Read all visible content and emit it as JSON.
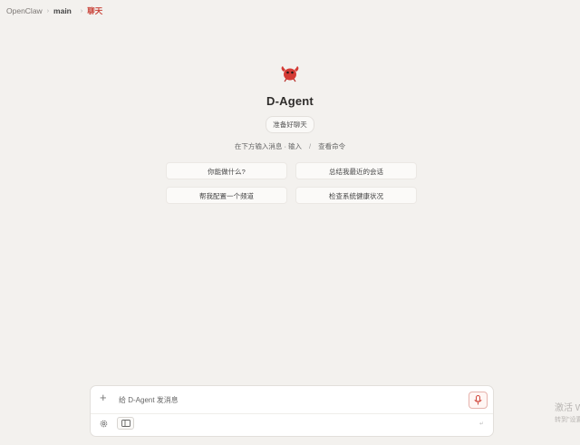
{
  "breadcrumb": {
    "root": "OpenClaw",
    "workspace": "main",
    "current": "聊天"
  },
  "agent": {
    "name": "D-Agent",
    "status_badge": "准备好聊天",
    "hint_left": "在下方输入消息 · 输入",
    "hint_sep": "/",
    "hint_right": "查看命令"
  },
  "suggestions": [
    "你能做什么?",
    "总结我最近的会话",
    "帮我配置一个频道",
    "检查系统健康状况"
  ],
  "composer": {
    "placeholder": "给 D-Agent 发消息",
    "send_hint": "↵"
  },
  "watermark": {
    "line1": "激活 Windows",
    "line2": "转到\"设置\"以激活"
  },
  "colors": {
    "accent": "#c9453b",
    "background": "#f3f1ee"
  },
  "icons": {
    "logo": "lobster-logo-icon",
    "plus": "plus-icon",
    "mic": "microphone-icon",
    "settings": "gear-icon",
    "panel": "sidebar-panel-icon"
  }
}
